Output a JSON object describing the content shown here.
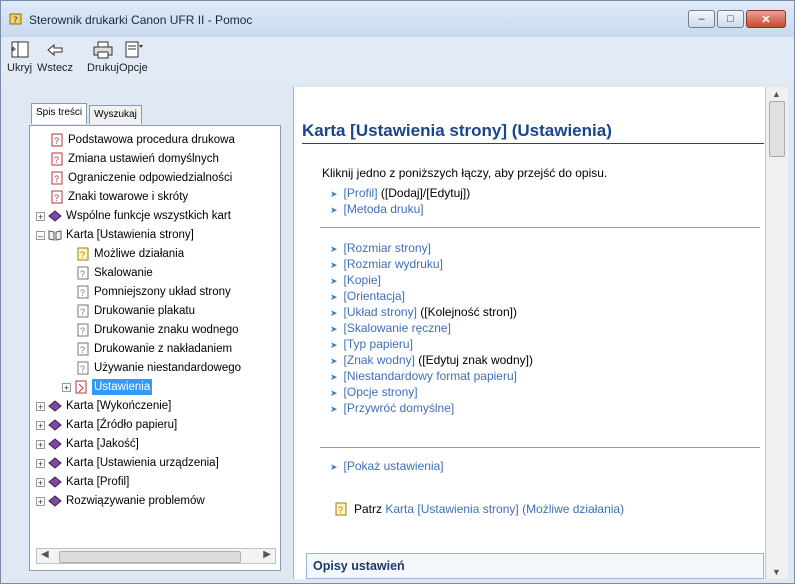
{
  "window": {
    "title": "Sterownik drukarki Canon UFR II - Pomoc"
  },
  "toolbar": {
    "hide": "Ukryj",
    "back": "Wstecz",
    "print": "Drukuj",
    "options": "Opcje"
  },
  "tabs": {
    "contents": "Spis treści",
    "search": "Wyszukaj"
  },
  "tree": [
    "Podstawowa procedura drukowa",
    "Zmiana ustawień domyślnych",
    "Ograniczenie odpowiedzialności",
    "Znaki towarowe i skróty",
    "Wspólne funkcje wszystkich kart",
    "Karta [Ustawienia strony]",
    "Możliwe działania",
    "Skalowanie",
    "Pomniejszony układ strony",
    "Drukowanie plakatu",
    "Drukowanie znaku wodnego",
    "Drukowanie z nakładaniem",
    "Używanie niestandardowego",
    "Ustawienia",
    "Karta [Wykończenie]",
    "Karta [Źródło papieru]",
    "Karta [Jakość]",
    "Karta [Ustawienia urządzenia]",
    "Karta [Profil]",
    "Rozwiązywanie problemów"
  ],
  "content": {
    "title": "Karta [Ustawienia strony] (Ustawienia)",
    "intro": "Kliknij jedno z poniższych łączy, aby przejść do opisu.",
    "group1": [
      {
        "link": "[Profil]",
        "extra": " ([Dodaj]/[Edytuj])"
      },
      {
        "link": "[Metoda druku]",
        "extra": ""
      }
    ],
    "group2": [
      {
        "link": "[Rozmiar strony]",
        "extra": ""
      },
      {
        "link": "[Rozmiar wydruku]",
        "extra": ""
      },
      {
        "link": "[Kopie]",
        "extra": ""
      },
      {
        "link": "[Orientacja]",
        "extra": ""
      },
      {
        "link": "[Układ strony]",
        "extra": " ([Kolejność stron])"
      },
      {
        "link": "[Skalowanie ręczne]",
        "extra": ""
      },
      {
        "link": "[Typ papieru]",
        "extra": ""
      },
      {
        "link": "[Znak wodny]",
        "extra": " ([Edytuj znak wodny])"
      },
      {
        "link": "[Niestandardowy format papieru]",
        "extra": ""
      },
      {
        "link": "[Opcje strony]",
        "extra": ""
      },
      {
        "link": "[Przywróć domyślne]",
        "extra": ""
      }
    ],
    "group3": [
      {
        "link": "[Pokaż ustawienia]",
        "extra": ""
      }
    ],
    "see_also_prefix": "Patrz ",
    "see_also_link": "Karta [Ustawienia strony] (Możliwe działania)",
    "descriptions_heading": "Opisy ustawień"
  }
}
